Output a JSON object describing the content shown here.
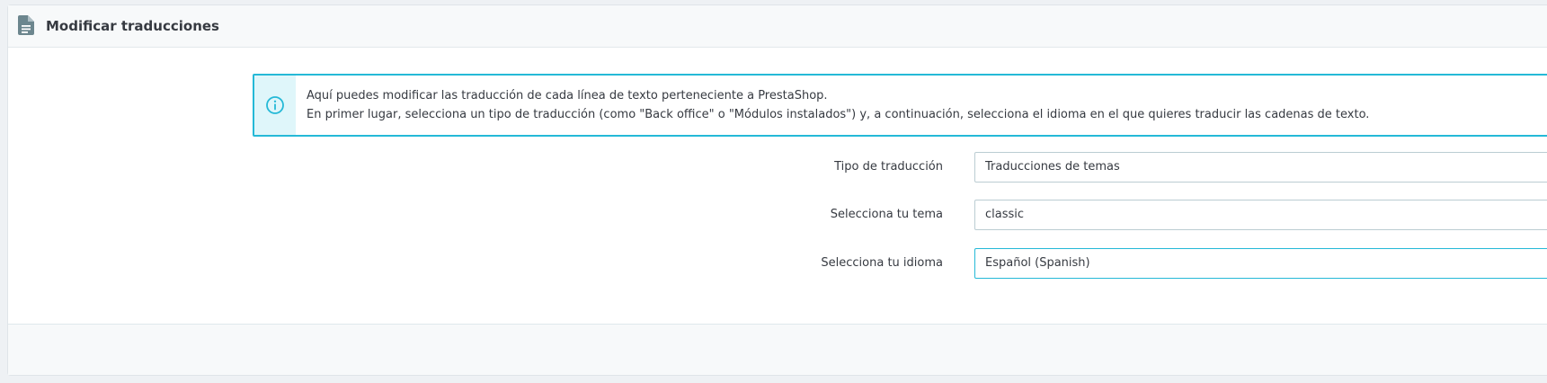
{
  "panel": {
    "title": "Modificar traducciones",
    "header_icon": "document-icon"
  },
  "alert": {
    "icon": "info-circle-icon",
    "line1": "Aquí puedes modificar las traducción de cada línea de texto perteneciente a PrestaShop.",
    "line2": "En primer lugar, selecciona un tipo de traducción (como \"Back office\" o \"Módulos instalados\") y, a continuación, selecciona el idioma en el que quieres traducir las cadenas de texto."
  },
  "form": {
    "translation_type": {
      "label": "Tipo de traducción",
      "value": "Traducciones de temas"
    },
    "theme": {
      "label": "Selecciona tu tema",
      "value": "classic"
    },
    "language": {
      "label": "Selecciona tu idioma",
      "value": "Español (Spanish)"
    }
  },
  "colors": {
    "accent": "#25b9d7",
    "alert_icon_bg": "#dff6fa",
    "page_bg": "#eef1f4",
    "text": "#363a41"
  }
}
